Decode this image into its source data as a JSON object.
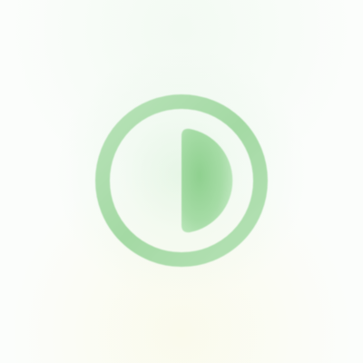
{
  "icon": {
    "name": "half-circle-contrast-icon",
    "ring_color": "#a8dca8",
    "fill_color": "#8fcf8f",
    "background": "#fbfdfb"
  }
}
